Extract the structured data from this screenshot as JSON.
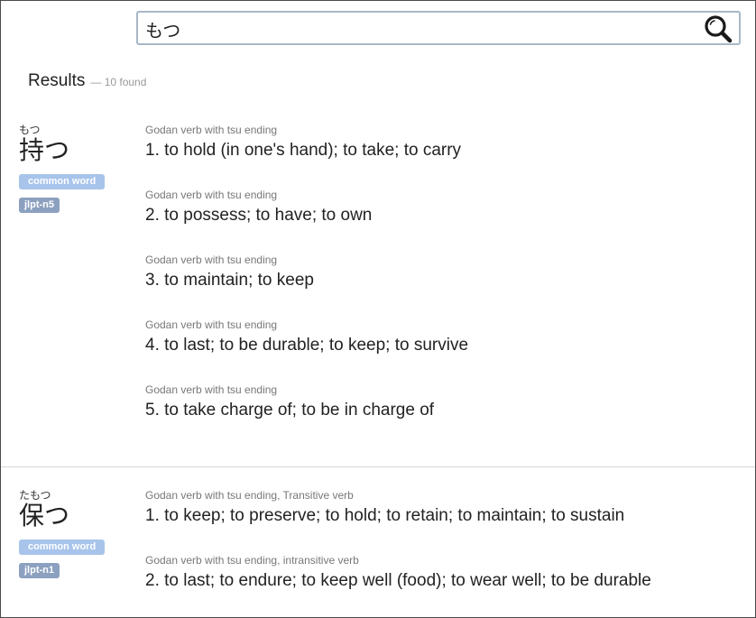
{
  "search": {
    "value": "もつ",
    "icon": "magnifier-icon"
  },
  "results": {
    "title": "Results",
    "count": "— 10 found"
  },
  "entries": [
    {
      "reading": "もつ",
      "word": "持つ",
      "tags": {
        "common": "common word",
        "jlpt": "jlpt-n5"
      },
      "senses": [
        {
          "pos": "Godan verb with tsu ending",
          "gloss": "1. to hold (in one's hand); to take; to carry"
        },
        {
          "pos": "Godan verb with tsu ending",
          "gloss": "2. to possess; to have; to own"
        },
        {
          "pos": "Godan verb with tsu ending",
          "gloss": "3. to maintain; to keep"
        },
        {
          "pos": "Godan verb with tsu ending",
          "gloss": "4. to last; to be durable; to keep; to survive"
        },
        {
          "pos": "Godan verb with tsu ending",
          "gloss": "5. to take charge of; to be in charge of"
        }
      ]
    },
    {
      "reading": "たもつ",
      "word": "保つ",
      "tags": {
        "common": "common word",
        "jlpt": "jlpt-n1"
      },
      "senses": [
        {
          "pos": "Godan verb with tsu ending, Transitive verb",
          "gloss": "1. to keep; to preserve; to hold; to retain; to maintain; to sustain"
        },
        {
          "pos": "Godan verb with tsu ending, intransitive verb",
          "gloss": "2. to last; to endure; to keep well (food); to wear well; to be durable"
        }
      ]
    }
  ],
  "colors": {
    "common_tag": "#a8c4ea",
    "jlpt_tag": "#8ca0bf",
    "search_border": "#a9b7c6"
  }
}
